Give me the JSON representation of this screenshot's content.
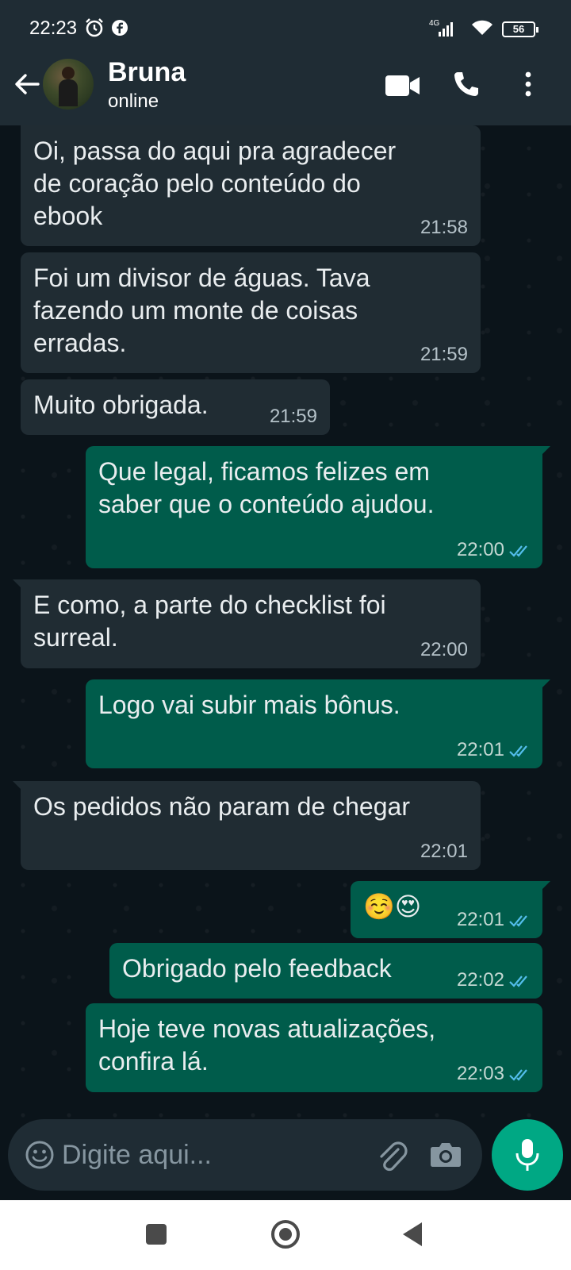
{
  "status_bar": {
    "time": "22:23",
    "network": "4G",
    "battery": "56"
  },
  "header": {
    "contact_name": "Bruna",
    "contact_status": "online",
    "icons": [
      "back-arrow-icon",
      "video-call-icon",
      "voice-call-icon",
      "more-options-icon"
    ]
  },
  "messages": [
    {
      "direction": "in",
      "text": "Oi, passa do aqui pra agradecer\nde coração pelo conteúdo do\nebook",
      "time": "21:58"
    },
    {
      "direction": "in",
      "text": "Foi um divisor de águas. Tava\nfazendo um monte de coisas\nerradas.",
      "time": "21:59"
    },
    {
      "direction": "in",
      "text": "Muito obrigada.",
      "time": "21:59"
    },
    {
      "direction": "out",
      "text": "Que legal, ficamos felizes em\nsaber que o conteúdo ajudou.",
      "time": "22:00",
      "read": true
    },
    {
      "direction": "in",
      "text": "E como, a parte do checklist foi\nsurreal.",
      "time": "22:00"
    },
    {
      "direction": "out",
      "text": "Logo vai subir mais bônus.",
      "time": "22:01",
      "read": true
    },
    {
      "direction": "in",
      "text": "Os pedidos não param de chegar",
      "time": "22:01"
    },
    {
      "direction": "out",
      "text": "☺️😍",
      "time": "22:01",
      "read": true
    },
    {
      "direction": "out",
      "text": "Obrigado pelo feedback",
      "time": "22:02",
      "read": true
    },
    {
      "direction": "out",
      "text": "Hoje teve novas atualizações,\nconfira lá.",
      "time": "22:03",
      "read": true
    }
  ],
  "composer": {
    "placeholder": "Digite aqui...",
    "icons": [
      "emoji-icon",
      "attach-icon",
      "camera-icon",
      "mic-icon"
    ]
  },
  "colors": {
    "header_bg": "#1f2c34",
    "chat_bg": "#0b141a",
    "incoming_bubble": "#202c33",
    "outgoing_bubble": "#005c4b",
    "accent": "#00a884",
    "read_ticks": "#53bdeb"
  }
}
